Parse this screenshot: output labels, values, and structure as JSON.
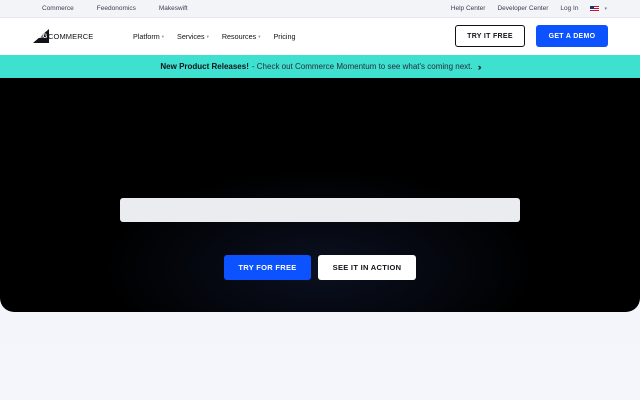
{
  "utility_bar": {
    "left_links": [
      "Commerce",
      "Feedonomics",
      "Makeswift"
    ],
    "right_links": [
      "Help Center",
      "Developer Center",
      "Log In"
    ],
    "locale_icon": "us-flag-icon"
  },
  "nav": {
    "logo_big": "BIG",
    "logo_commerce": "COMMERCE",
    "items": [
      {
        "label": "Platform",
        "has_dropdown": true
      },
      {
        "label": "Services",
        "has_dropdown": true
      },
      {
        "label": "Resources",
        "has_dropdown": true
      },
      {
        "label": "Pricing",
        "has_dropdown": false
      }
    ],
    "try_label": "TRY IT FREE",
    "demo_label": "GET A DEMO"
  },
  "banner": {
    "bold": "New Product Releases!",
    "message": "- Check out Commerce Momentum to see what's coming next.",
    "icon": "double-chevron-right-icon"
  },
  "hero": {
    "primary_label": "TRY FOR FREE",
    "secondary_label": "SEE IT IN ACTION"
  },
  "colors": {
    "accent_blue": "#0d52ff",
    "banner_teal": "#3ee0cf",
    "hero_bg": "#000000"
  }
}
